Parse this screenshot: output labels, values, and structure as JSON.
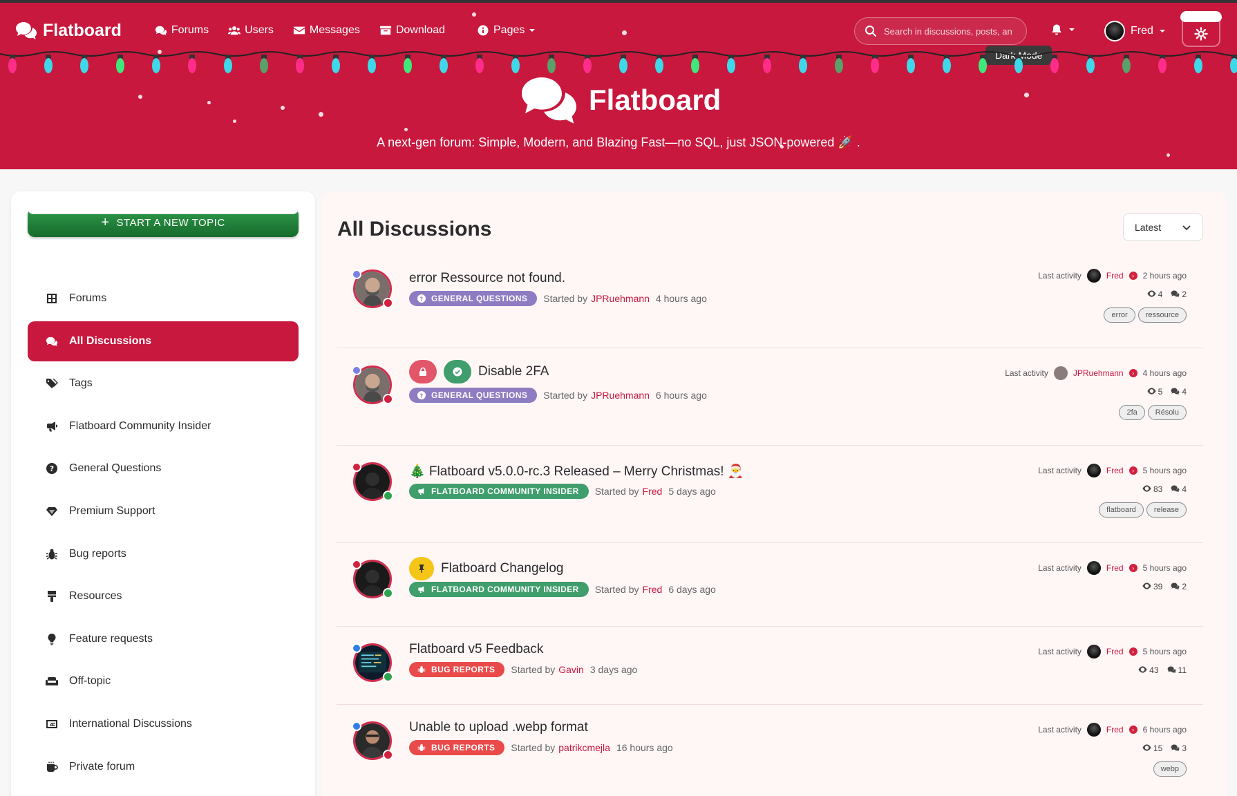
{
  "brand": {
    "name": "Flatboard"
  },
  "nav": {
    "links": [
      {
        "label": "Forums",
        "icon": "comments-icon"
      },
      {
        "label": "Users",
        "icon": "users-icon"
      },
      {
        "label": "Messages",
        "icon": "envelope-icon"
      },
      {
        "label": "Download",
        "icon": "archive-icon"
      },
      {
        "label": "Pages",
        "icon": "info-icon"
      }
    ],
    "search_placeholder": "Search in discussions, posts, an",
    "user_name": "Fred",
    "tooltip": "Dark Mode"
  },
  "hero": {
    "title": "Flatboard",
    "subtitle": "A next-gen forum: Simple, Modern, and Blazing Fast—no SQL, just JSON-powered 🚀 ."
  },
  "sidebar": {
    "new_topic_label": "START A NEW TOPIC",
    "items": [
      {
        "label": "Forums",
        "icon": "grid-icon",
        "active": false
      },
      {
        "label": "All Discussions",
        "icon": "comments-icon",
        "active": true
      },
      {
        "label": "Tags",
        "icon": "tags-icon",
        "active": false
      },
      {
        "label": "Flatboard Community Insider",
        "icon": "bullhorn-icon",
        "active": false
      },
      {
        "label": "General Questions",
        "icon": "question-icon",
        "active": false
      },
      {
        "label": "Premium Support",
        "icon": "gem-icon",
        "active": false
      },
      {
        "label": "Bug reports",
        "icon": "bug-icon",
        "active": false
      },
      {
        "label": "Resources",
        "icon": "brush-icon",
        "active": false
      },
      {
        "label": "Feature requests",
        "icon": "lightbulb-icon",
        "active": false
      },
      {
        "label": "Off-topic",
        "icon": "couch-icon",
        "active": false
      },
      {
        "label": "International Discussions",
        "icon": "language-icon",
        "active": false
      },
      {
        "label": "Private forum",
        "icon": "mug-icon",
        "active": false
      }
    ]
  },
  "main": {
    "title": "All Discussions",
    "sort_value": "Latest",
    "last_activity_label": "Last activity",
    "started_by_label": "Started by",
    "discussions": [
      {
        "title": "error Ressource not found.",
        "category": "GENERAL QUESTIONS",
        "cat_color": "#8e7cc3",
        "author": "JPRuehmann",
        "started": "4 hours ago",
        "last_user": "Fred",
        "last_time": "2 hours ago",
        "views": "4",
        "replies": "2",
        "tags": [
          "error",
          "ressource"
        ]
      },
      {
        "title": "Disable 2FA",
        "category": "GENERAL QUESTIONS",
        "cat_color": "#8e7cc3",
        "author": "JPRuehmann",
        "started": "6 hours ago",
        "last_user": "JPRuehmann",
        "last_time": "4 hours ago",
        "views": "5",
        "replies": "4",
        "tags": [
          "2fa",
          "Résolu"
        ]
      },
      {
        "title": "🎄 Flatboard v5.0.0-rc.3 Released – Merry Christmas! 🎅",
        "category": "FLATBOARD COMMUNITY INSIDER",
        "cat_color": "#3f9e6b",
        "author": "Fred",
        "started": "5 days ago",
        "last_user": "Fred",
        "last_time": "5 hours ago",
        "views": "83",
        "replies": "4",
        "tags": [
          "flatboard",
          "release"
        ]
      },
      {
        "title": "Flatboard Changelog",
        "category": "FLATBOARD COMMUNITY INSIDER",
        "cat_color": "#3f9e6b",
        "author": "Fred",
        "started": "6 days ago",
        "last_user": "Fred",
        "last_time": "5 hours ago",
        "views": "39",
        "replies": "2",
        "tags": []
      },
      {
        "title": "Flatboard v5 Feedback",
        "category": "BUG REPORTS",
        "cat_color": "#e94a4a",
        "author": "Gavin",
        "started": "3 days ago",
        "last_user": "Fred",
        "last_time": "5 hours ago",
        "views": "43",
        "replies": "11",
        "tags": []
      },
      {
        "title": "Unable to upload .webp format",
        "category": "BUG REPORTS",
        "cat_color": "#e94a4a",
        "author": "patrikcmejla",
        "started": "16 hours ago",
        "last_user": "Fred",
        "last_time": "6 hours ago",
        "views": "15",
        "replies": "3",
        "tags": [
          "webp"
        ]
      }
    ]
  }
}
